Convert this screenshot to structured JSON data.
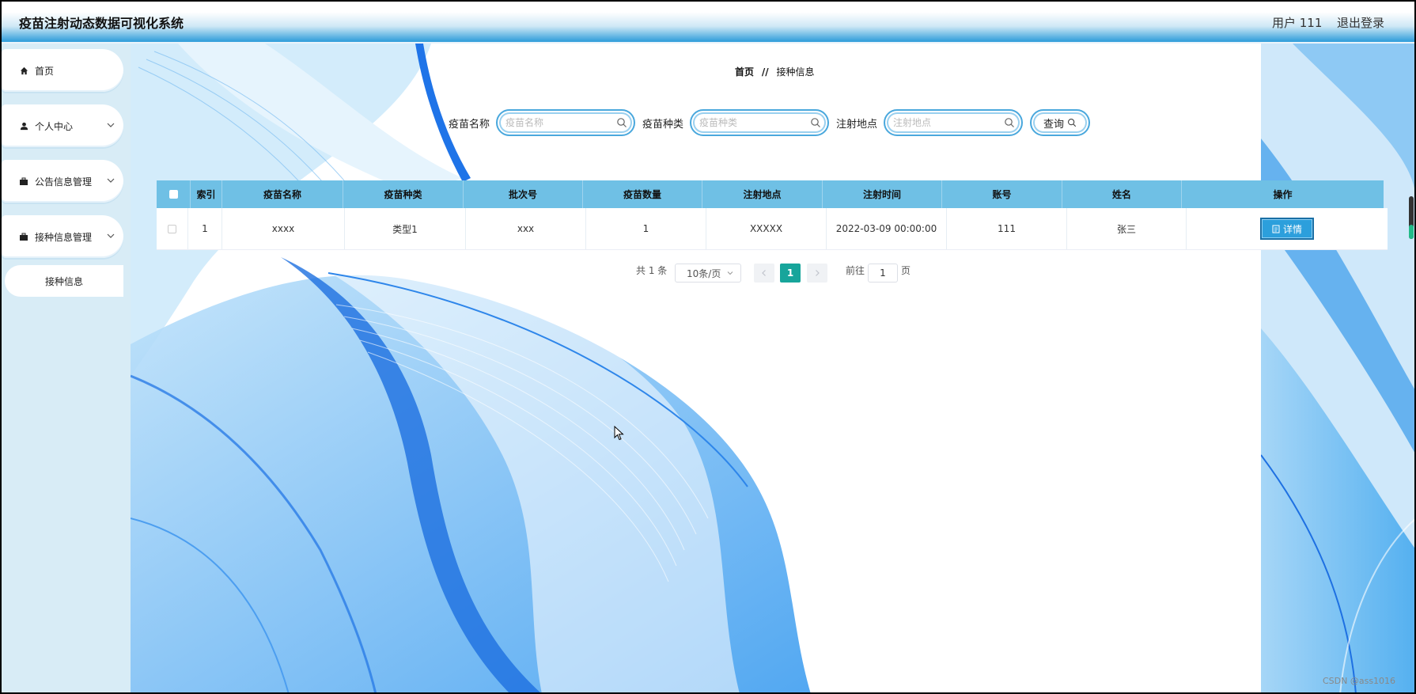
{
  "app": {
    "title": "疫苗注射动态数据可视化系统",
    "user_label": "用户 111",
    "logout_label": "退出登录"
  },
  "sidebar": {
    "items": [
      {
        "label": "首页",
        "icon": "home-icon"
      },
      {
        "label": "个人中心",
        "icon": "user-icon"
      },
      {
        "label": "公告信息管理",
        "icon": "briefcase-icon"
      },
      {
        "label": "接种信息管理",
        "icon": "briefcase-icon"
      }
    ],
    "submenu": {
      "label": "接种信息"
    }
  },
  "breadcrumb": {
    "home": "首页",
    "separator": "//",
    "current": "接种信息"
  },
  "search": {
    "name_label": "疫苗名称",
    "name_placeholder": "疫苗名称",
    "type_label": "疫苗种类",
    "type_placeholder": "疫苗种类",
    "place_label": "注射地点",
    "place_placeholder": "注射地点",
    "query_label": "查询"
  },
  "table": {
    "headers": [
      "索引",
      "疫苗名称",
      "疫苗种类",
      "批次号",
      "疫苗数量",
      "注射地点",
      "注射时间",
      "账号",
      "姓名",
      "操作"
    ],
    "rows": [
      {
        "index": "1",
        "name": "xxxx",
        "type": "类型1",
        "batch": "xxx",
        "quantity": "1",
        "place": "XXXXX",
        "time": "2022-03-09 00:00:00",
        "account": "111",
        "person": "张三",
        "action": "详情"
      }
    ]
  },
  "pagination": {
    "total": "共 1 条",
    "page_size": "10条/页",
    "current_page": "1",
    "goto_label": "前往",
    "goto_value": "1",
    "page_suffix": "页"
  },
  "watermark": "CSDN @ass1016",
  "colors": {
    "accent": "#39a2dc",
    "table_header": "#6fc0e5",
    "page_active": "#17a59b",
    "detail_button": "#2c9fdc"
  }
}
